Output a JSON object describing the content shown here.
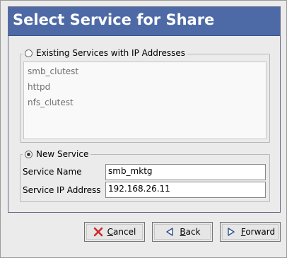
{
  "dialog": {
    "title": "Select Service for Share"
  },
  "existing_services": {
    "label": "Existing Services with IP Addresses",
    "selected": false,
    "items": [
      "smb_clutest",
      "httpd",
      "nfs_clutest"
    ]
  },
  "new_service": {
    "label": "New Service",
    "selected": true,
    "service_name_label": "Service Name",
    "service_name_value": "smb_mktg",
    "service_ip_label": "Service IP Address",
    "service_ip_value": "192.168.26.11"
  },
  "buttons": {
    "cancel": {
      "mnemonic": "C",
      "rest": "ancel",
      "icon": "cancel-x-icon"
    },
    "back": {
      "mnemonic": "B",
      "rest": "ack",
      "icon": "back-arrow-icon"
    },
    "forward": {
      "mnemonic": "F",
      "rest": "orward",
      "icon": "forward-arrow-icon"
    }
  },
  "colors": {
    "title_bar": "#4d6aa6",
    "cancel_icon": "#cc2a2a",
    "arrow_icon": "#2d4a8a"
  }
}
